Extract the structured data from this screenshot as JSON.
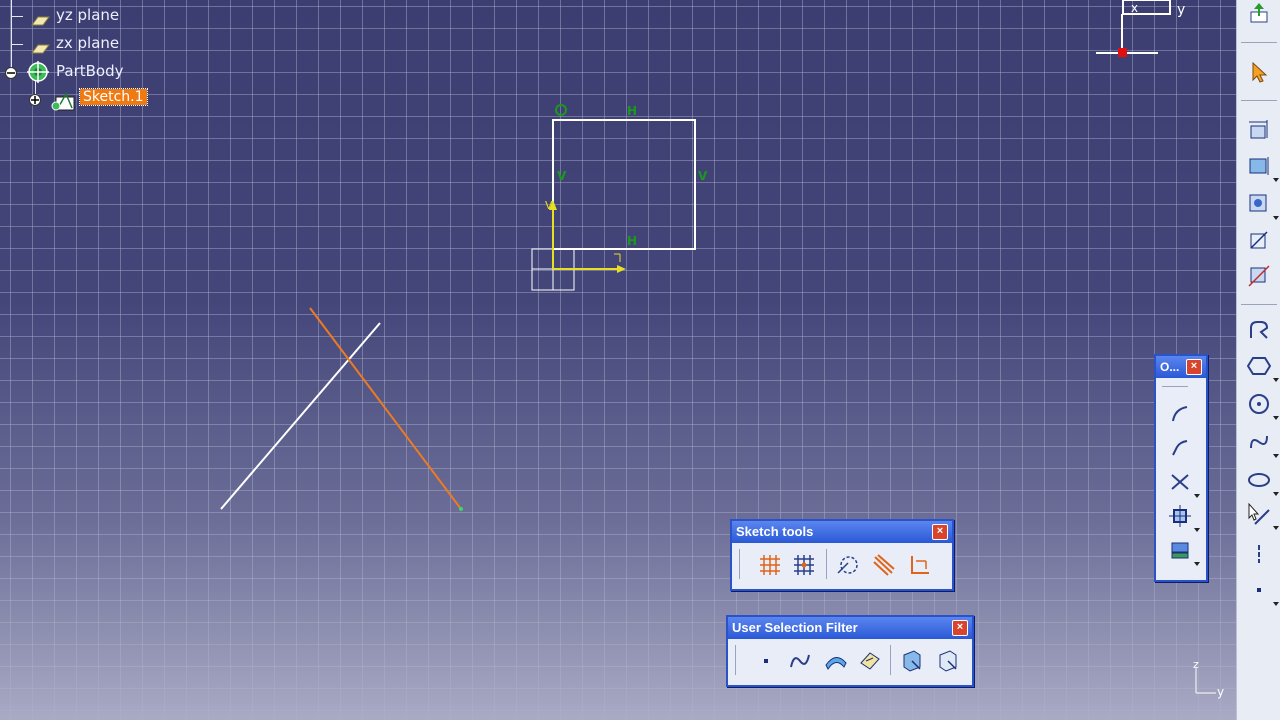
{
  "tree": {
    "items": [
      {
        "label": "yz plane"
      },
      {
        "label": "zx plane"
      },
      {
        "label": "PartBody"
      },
      {
        "label": "Sketch.1"
      }
    ]
  },
  "constraints": {
    "origin": "O",
    "top_h": "H",
    "left_v": "V",
    "right_v": "V",
    "bottom_h": "H",
    "v_marker": "V"
  },
  "compass": {
    "x": "x",
    "y": "y"
  },
  "corner_axis": {
    "z": "z",
    "y": "y"
  },
  "profile_toolbar": {
    "title": "O...",
    "close": "×"
  },
  "sketch_tools": {
    "title": "Sketch tools",
    "close": "×"
  },
  "user_selection_filter": {
    "title": "User Selection Filter",
    "close": "×"
  },
  "colors": {
    "background_top": "#3c3e72",
    "grid": "#aab2cd",
    "selection": "#f07a12",
    "toolbar_title": "#2a58d6",
    "axis_yellow": "#e6e020",
    "constraint_green": "#1a9a1a"
  }
}
